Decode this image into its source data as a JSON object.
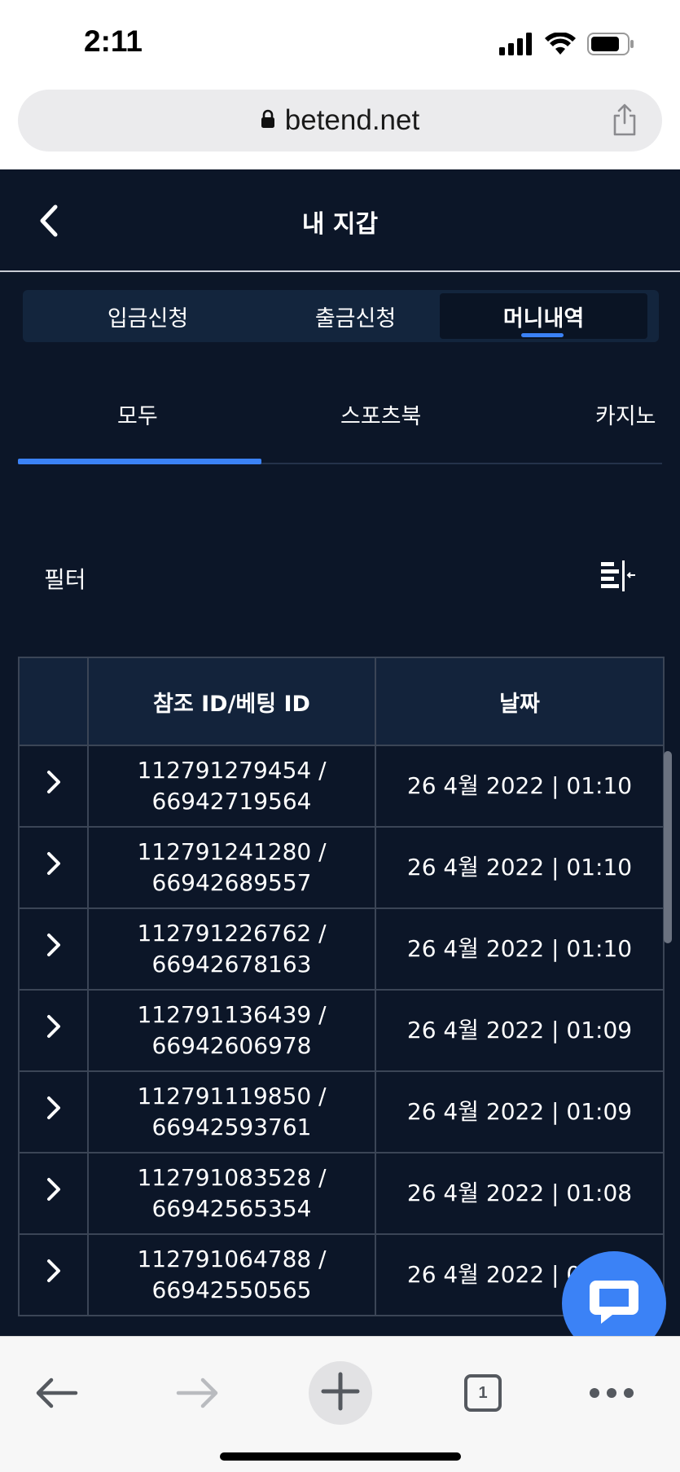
{
  "status_bar": {
    "time": "2:11",
    "icons": [
      "signal-icon",
      "wifi-icon",
      "battery-icon"
    ]
  },
  "browser": {
    "url": "betend.net",
    "tab_count": "1"
  },
  "header": {
    "title": "내 지갑"
  },
  "segments": [
    {
      "label": "입금신청",
      "active": false
    },
    {
      "label": "출금신청",
      "active": false
    },
    {
      "label": "머니내역",
      "active": true
    }
  ],
  "subtabs": [
    {
      "label": "모두",
      "active": true
    },
    {
      "label": "스포츠북",
      "active": false
    },
    {
      "label": "카지노",
      "active": false
    }
  ],
  "filter": {
    "label": "필터"
  },
  "table": {
    "headers": [
      "",
      "참조 ID/베팅 ID",
      "날짜"
    ],
    "rows": [
      {
        "ref_id": "112791279454 /",
        "bet_id": "66942719564",
        "date": "26 4월 2022 | 01:10"
      },
      {
        "ref_id": "112791241280 /",
        "bet_id": "66942689557",
        "date": "26 4월 2022 | 01:10"
      },
      {
        "ref_id": "112791226762 /",
        "bet_id": "66942678163",
        "date": "26 4월 2022 | 01:10"
      },
      {
        "ref_id": "112791136439 /",
        "bet_id": "66942606978",
        "date": "26 4월 2022 | 01:09"
      },
      {
        "ref_id": "112791119850 /",
        "bet_id": "66942593761",
        "date": "26 4월 2022 | 01:09"
      },
      {
        "ref_id": "112791083528 /",
        "bet_id": "66942565354",
        "date": "26 4월 2022 | 01:08"
      },
      {
        "ref_id": "112791064788 /",
        "bet_id": "66942550565",
        "date": "26 4월 2022 | 01:08"
      }
    ]
  },
  "colors": {
    "app_bg": "#0c1628",
    "accent": "#3b82f6",
    "header_cell": "#13233b"
  }
}
